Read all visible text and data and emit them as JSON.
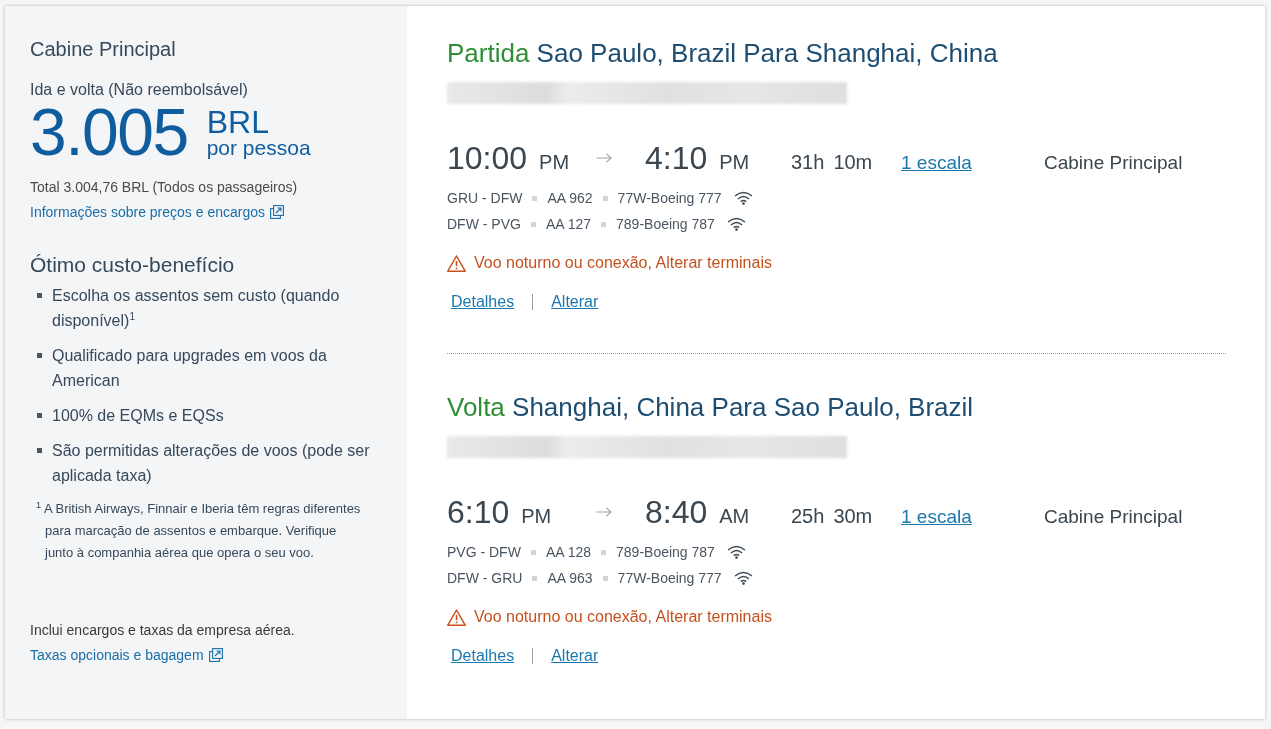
{
  "fare_panel": {
    "cabin": "Cabine Principal",
    "trip_type": "Ida e volta (Não reembolsável)",
    "price": "3.005",
    "currency": "BRL",
    "price_unit": "por pessoa",
    "total": "Total 3.004,76 BRL (Todos os passageiros)",
    "price_info_link": "Informações sobre preços e encargos",
    "benefits_title": "Ótimo custo-benefício",
    "benefits": [
      "Escolha os assentos sem custo (quando disponível)$^{1}$",
      "Qualificado para upgrades em voos da American",
      "100% de EQMs e EQSs",
      "São permitidas alterações de voos (pode ser aplicada taxa)"
    ],
    "footnote": "$^{1}$ A British Airways, Finnair e Iberia têm regras diferentes para marcação de assentos e embarque. Verifique junto à companhia aérea que opera o seu voo.",
    "fees_note": "Inclui encargos e taxas da empresa aérea.",
    "fees_link": "Taxas opcionais e bagagem"
  },
  "trips": [
    {
      "label": "Partida",
      "route": "Sao Paulo, Brazil Para Shanghai, China",
      "depart_time": "10:00",
      "depart_period": "PM",
      "arrive_time": "4:10",
      "arrive_period": "PM",
      "duration_hours": "31h",
      "duration_minutes": "10m",
      "stops_link": "1 escala",
      "cabin": "Cabine Principal",
      "segments": [
        {
          "route": "GRU - DFW",
          "flight": "AA 962",
          "aircraft": "77W-Boeing 777",
          "wifi": true
        },
        {
          "route": "DFW - PVG",
          "flight": "AA 127",
          "aircraft": "789-Boeing 787",
          "wifi": true
        }
      ],
      "notice": "Voo noturno ou conexão, Alterar terminais",
      "links": [
        "Detalhes",
        "Alterar"
      ]
    },
    {
      "label": "Volta",
      "route": "Shanghai, China Para Sao Paulo, Brazil",
      "depart_time": "6:10",
      "depart_period": "PM",
      "arrive_time": "8:40",
      "arrive_period": "AM",
      "duration_hours": "25h",
      "duration_minutes": "30m",
      "stops_link": "1 escala",
      "cabin": "Cabine Principal",
      "segments": [
        {
          "route": "PVG - DFW",
          "flight": "AA 128",
          "aircraft": "789-Boeing 787",
          "wifi": true
        },
        {
          "route": "DFW - GRU",
          "flight": "AA 963",
          "aircraft": "77W-Boeing 777",
          "wifi": true
        }
      ],
      "notice": "Voo noturno ou conexão, Alterar terminais",
      "links": [
        "Detalhes",
        "Alterar"
      ]
    }
  ]
}
